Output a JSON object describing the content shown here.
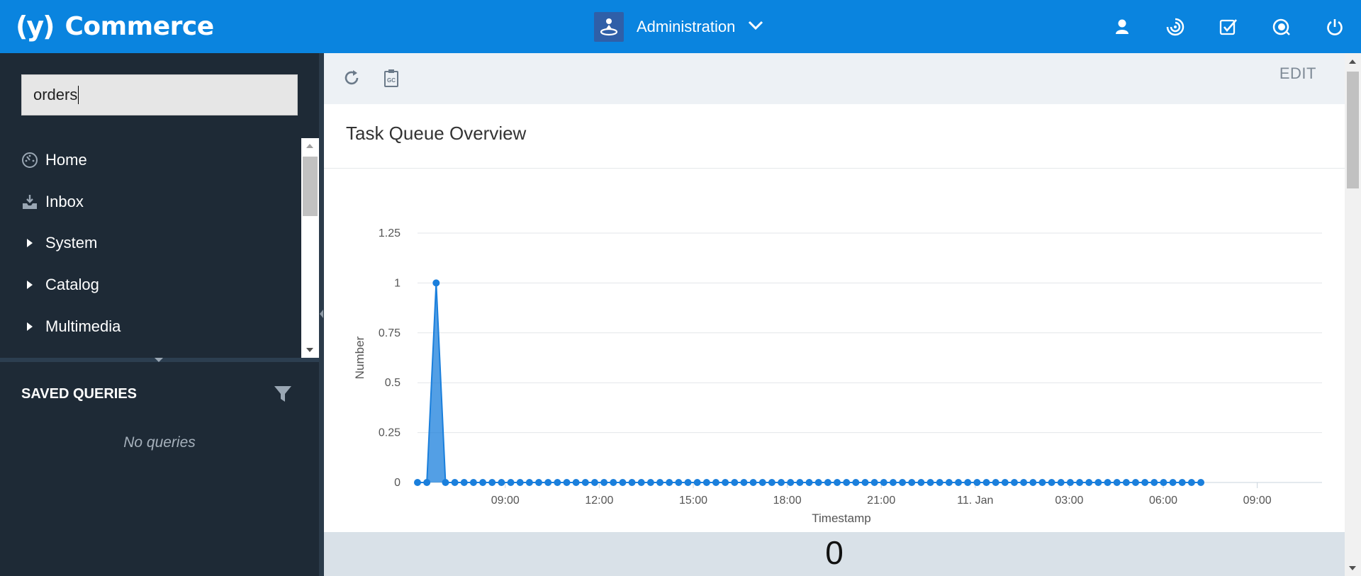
{
  "app": {
    "logo_mark": "(y)",
    "name": "Commerce",
    "perspective": "Administration",
    "brand_color": "#0a84df",
    "header_icons": [
      "user-icon",
      "sync-icon",
      "tasks-checkbox-icon",
      "global-search-icon",
      "power-icon"
    ]
  },
  "sidebar": {
    "search_value": "orders",
    "items": [
      {
        "label": "Home",
        "icon": "dashboard-gauge-icon"
      },
      {
        "label": "Inbox",
        "icon": "inbox-tray-icon"
      },
      {
        "label": "System",
        "icon": "caret-right-icon"
      },
      {
        "label": "Catalog",
        "icon": "caret-right-icon"
      },
      {
        "label": "Multimedia",
        "icon": "caret-right-icon"
      }
    ],
    "saved_queries_title": "SAVED QUERIES",
    "saved_queries_empty": "No queries"
  },
  "toolbar": {
    "edit_label": "EDIT",
    "icons": [
      "refresh-icon",
      "garbage-collect-icon"
    ]
  },
  "widget": {
    "title": "Task Queue Overview"
  },
  "stat_tile": {
    "value": "0"
  },
  "chart_data": {
    "type": "area",
    "title": "",
    "xlabel": "Timestamp",
    "ylabel": "Number",
    "ylim": [
      0,
      1.25
    ],
    "yticks": [
      0,
      0.25,
      0.5,
      0.75,
      1,
      1.25
    ],
    "yticklabels": [
      "0",
      "0.25",
      "0.5",
      "0.75",
      "1",
      "1.25"
    ],
    "xticklabels": [
      "09:00",
      "12:00",
      "15:00",
      "18:00",
      "21:00",
      "11. Jan",
      "03:00",
      "06:00",
      "09:00"
    ],
    "xlim_hours_start": "10 Jan 06:12",
    "xlim_hours_end": "11 Jan 11:04",
    "grid": true,
    "legend": "none",
    "point_interval_minutes": 17.3,
    "series": [
      {
        "color": "#1a7fdc",
        "start": "10 Jan 06:12",
        "end": "11 Jan 07:12",
        "count": 85,
        "values": [
          0,
          0,
          1,
          0,
          0,
          0,
          0,
          0,
          0,
          0,
          0,
          0,
          0,
          0,
          0,
          0,
          0,
          0,
          0,
          0,
          0,
          0,
          0,
          0,
          0,
          0,
          0,
          0,
          0,
          0,
          0,
          0,
          0,
          0,
          0,
          0,
          0,
          0,
          0,
          0,
          0,
          0,
          0,
          0,
          0,
          0,
          0,
          0,
          0,
          0,
          0,
          0,
          0,
          0,
          0,
          0,
          0,
          0,
          0,
          0,
          0,
          0,
          0,
          0,
          0,
          0,
          0,
          0,
          0,
          0,
          0,
          0,
          0,
          0,
          0,
          0,
          0,
          0,
          0,
          0,
          0,
          0,
          0,
          0,
          0
        ]
      }
    ]
  }
}
